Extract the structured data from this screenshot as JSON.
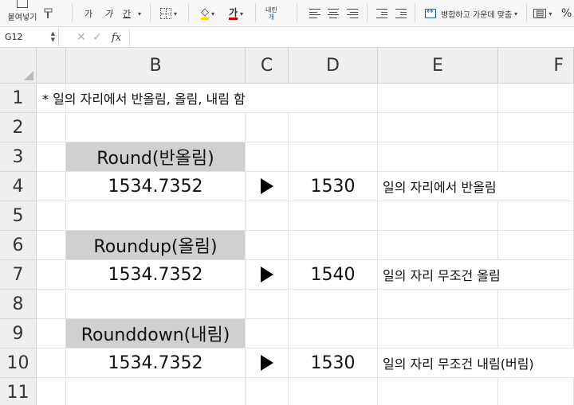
{
  "ribbon": {
    "paste_label": "붙여넣기",
    "font_buttons": [
      "가",
      "가",
      "간"
    ],
    "font_color_glyph": "가",
    "vertical_text_top": "내린",
    "vertical_text_bottom": "개",
    "merge_label": "병합하고 가운데 맞춤",
    "percent_label": "%",
    "icons": [
      "paste-icon",
      "format-painter-icon",
      "borders-icon",
      "fill-color-icon",
      "font-color-icon",
      "align-top-icon",
      "align-middle-icon",
      "align-bottom-icon",
      "decrease-indent-icon",
      "increase-indent-icon",
      "merge-center-icon",
      "number-format-icon"
    ],
    "colors": {
      "fill": "#ffd600",
      "font": "#d00000"
    }
  },
  "formula_bar": {
    "name_box": "G12",
    "cancel_glyph": "✕",
    "confirm_glyph": "✓",
    "fx_label": "fx",
    "formula": ""
  },
  "sheet": {
    "columns": [
      "B",
      "C",
      "D",
      "E",
      "F"
    ],
    "rows": [
      "1",
      "2",
      "3",
      "4",
      "5",
      "6",
      "7",
      "8",
      "9",
      "10",
      "11"
    ],
    "header_fill": "#d0d0d0",
    "cells": {
      "B1": "* 일의 자리에서 반올림, 올림, 내림 함",
      "B3": "Round(반올림)",
      "B4": "1534.7352",
      "D4": "1530",
      "E4": "일의 자리에서 반올림",
      "B6": "Roundup(올림)",
      "B7": "1534.7352",
      "D7": "1540",
      "E7": "일의 자리 무조건 올림",
      "B9": "Rounddown(내림)",
      "B10": "1534.7352",
      "D10": "1530",
      "E10": "일의 자리 무조건 내림(버림)"
    },
    "arrow_icon": "play-arrow-icon"
  }
}
